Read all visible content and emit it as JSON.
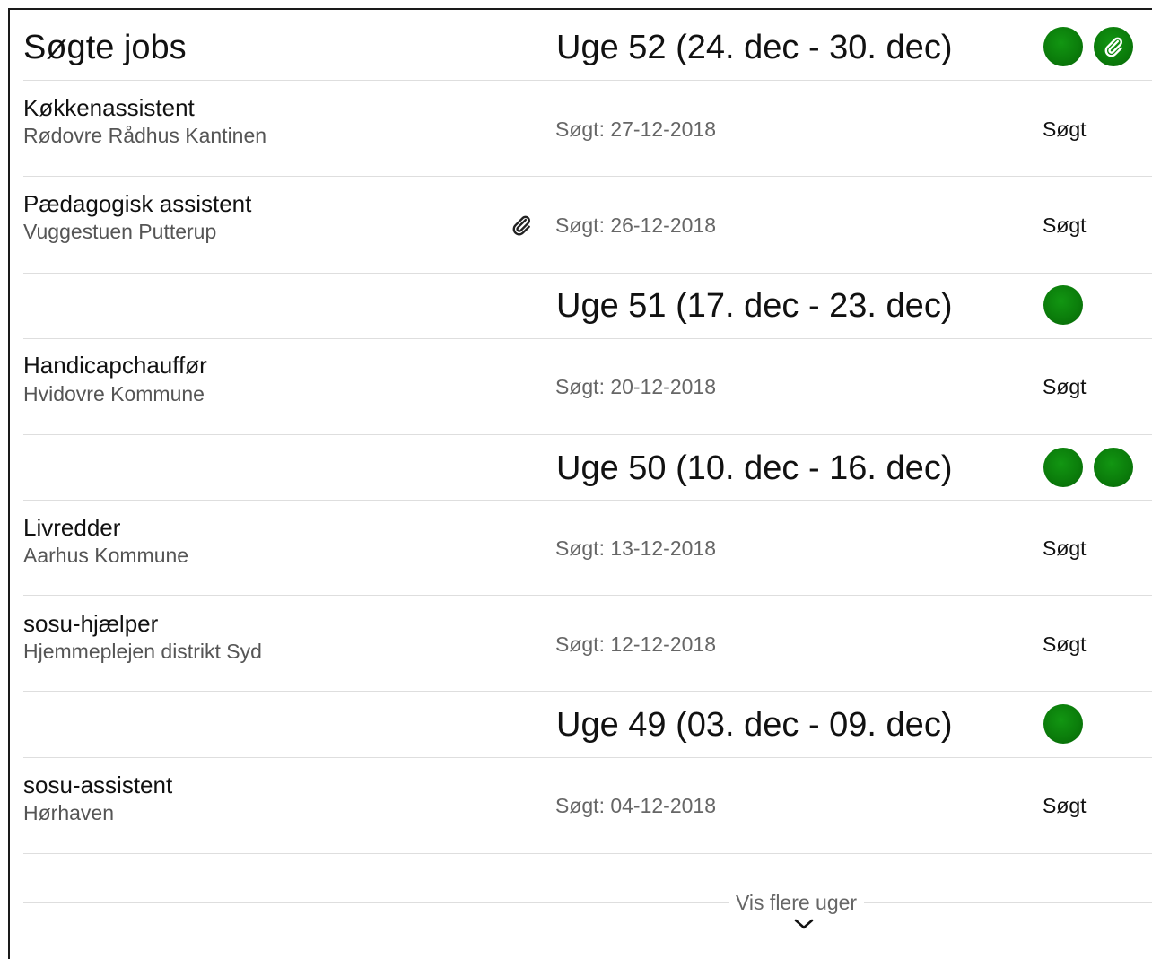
{
  "page_title": "Søgte jobs",
  "more_label": "Vis flere uger",
  "colors": {
    "accent_green": "#0b7d0b",
    "divider": "#dedede",
    "muted_text": "#666666"
  },
  "weeks": [
    {
      "label": "Uge 52 (24. dec - 30. dec)",
      "indicators": [
        "dot",
        "paperclip-dot"
      ]
    },
    {
      "label": "Uge 51 (17. dec - 23. dec)",
      "indicators": [
        "dot"
      ]
    },
    {
      "label": "Uge 50 (10. dec - 16. dec)",
      "indicators": [
        "dot",
        "dot"
      ]
    },
    {
      "label": "Uge 49 (03. dec - 09. dec)",
      "indicators": [
        "dot"
      ]
    }
  ],
  "jobs": [
    {
      "title": "Køkkenassistent",
      "company": "Rødovre Rådhus Kantinen",
      "date": "Søgt: 27-12-2018",
      "status": "Søgt",
      "attachment": false
    },
    {
      "title": "Pædagogisk assistent",
      "company": "Vuggestuen Putterup",
      "date": "Søgt: 26-12-2018",
      "status": "Søgt",
      "attachment": true
    },
    {
      "title": "Handicapchauffør",
      "company": "Hvidovre Kommune",
      "date": "Søgt: 20-12-2018",
      "status": "Søgt",
      "attachment": false
    },
    {
      "title": "Livredder",
      "company": "Aarhus Kommune",
      "date": "Søgt: 13-12-2018",
      "status": "Søgt",
      "attachment": false
    },
    {
      "title": "sosu-hjælper",
      "company": "Hjemmeplejen distrikt Syd",
      "date": "Søgt: 12-12-2018",
      "status": "Søgt",
      "attachment": false
    },
    {
      "title": "sosu-assistent",
      "company": "Hørhaven",
      "date": "Søgt: 04-12-2018",
      "status": "Søgt",
      "attachment": false
    }
  ]
}
